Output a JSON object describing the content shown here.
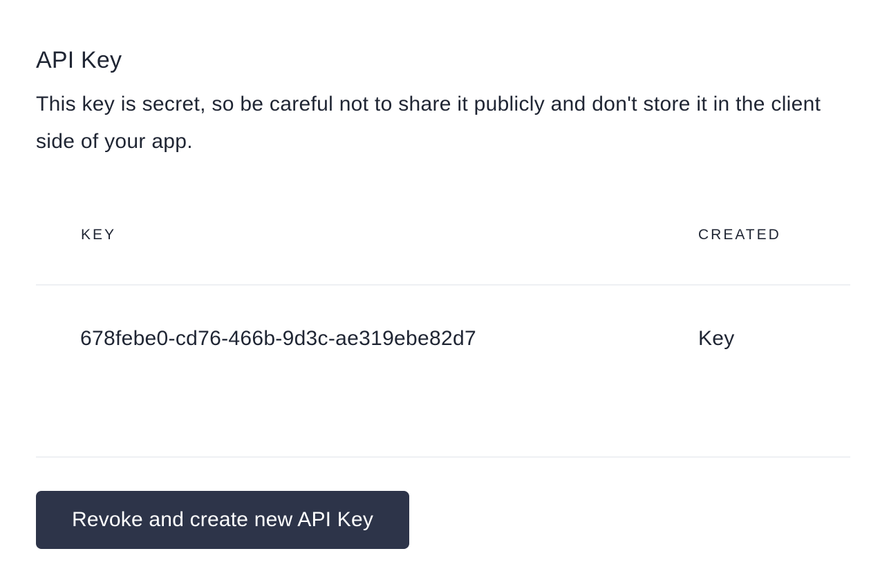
{
  "section": {
    "title": "API Key",
    "description": "This key is secret, so be careful not to share it publicly and don't store it in the client side of your app."
  },
  "table": {
    "columns": [
      "KEY",
      "CREATED"
    ],
    "rows": [
      {
        "key": "678febe0-cd76-466b-9d3c-ae319ebe82d7",
        "created": "Key"
      }
    ]
  },
  "actions": {
    "revoke_label": "Revoke and create new API Key"
  },
  "colors": {
    "text": "#1f2533",
    "button_bg": "#2d3449",
    "divider": "#eef0f3"
  }
}
